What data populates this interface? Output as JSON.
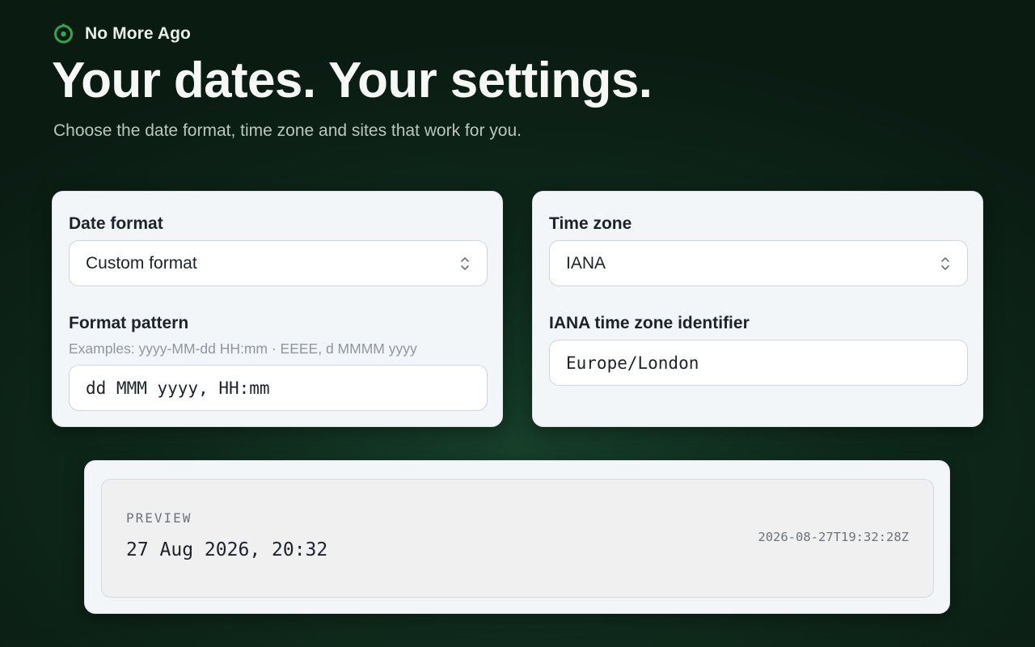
{
  "brand": {
    "name": "No More Ago",
    "icon": "target-clock-icon",
    "accent": "#2ea84a"
  },
  "hero": {
    "title": "Your dates. Your settings.",
    "subtitle": "Choose the date format, time zone and sites that work for you."
  },
  "date_card": {
    "format_label": "Date format",
    "format_selected": "Custom format",
    "pattern_label": "Format pattern",
    "pattern_hint": "Examples: yyyy-MM-dd HH:mm · EEEE, d MMMM yyyy",
    "pattern_value": "dd MMM yyyy, HH:mm"
  },
  "tz_card": {
    "tz_label": "Time zone",
    "tz_selected": "IANA",
    "identifier_label": "IANA time zone identifier",
    "identifier_value": "Europe/London"
  },
  "preview": {
    "label": "PREVIEW",
    "value": "27 Aug 2026, 20:32",
    "iso": "2026-08-27T19:32:28Z"
  }
}
